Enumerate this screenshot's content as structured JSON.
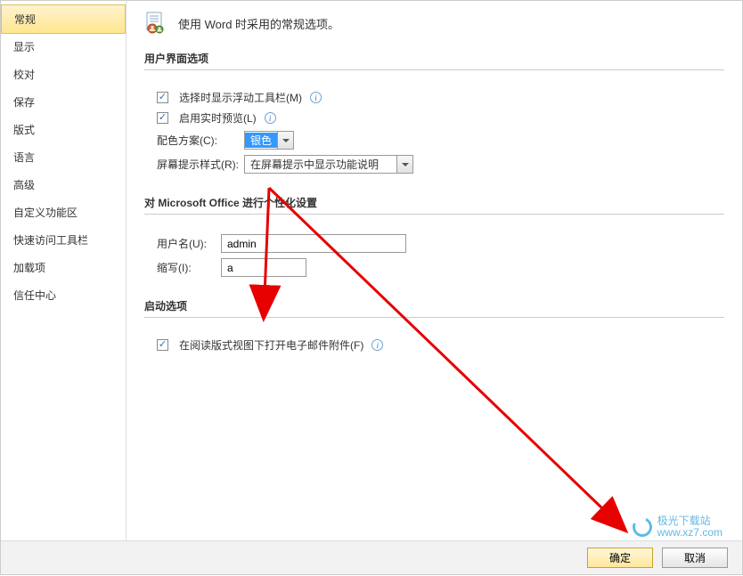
{
  "header": {
    "title": "使用 Word 时采用的常规选项。"
  },
  "sidebar": {
    "items": [
      {
        "label": "常规",
        "selected": true
      },
      {
        "label": "显示",
        "selected": false
      },
      {
        "label": "校对",
        "selected": false
      },
      {
        "label": "保存",
        "selected": false
      },
      {
        "label": "版式",
        "selected": false
      },
      {
        "label": "语言",
        "selected": false
      },
      {
        "label": "高级",
        "selected": false
      },
      {
        "label": "自定义功能区",
        "selected": false
      },
      {
        "label": "快速访问工具栏",
        "selected": false
      },
      {
        "label": "加载项",
        "selected": false
      },
      {
        "label": "信任中心",
        "selected": false
      }
    ]
  },
  "sections": {
    "ui_options": {
      "title": "用户界面选项",
      "show_mini_toolbar": {
        "label": "选择时显示浮动工具栏(M)",
        "checked": true
      },
      "live_preview": {
        "label": "启用实时预览(L)",
        "checked": true
      },
      "color_scheme": {
        "label": "配色方案(C):",
        "value": "银色"
      },
      "screentip": {
        "label": "屏幕提示样式(R):",
        "value": "在屏幕提示中显示功能说明"
      }
    },
    "personalize": {
      "title": "对 Microsoft Office 进行个性化设置",
      "username": {
        "label": "用户名(U):",
        "value": "admin"
      },
      "initials": {
        "label": "缩写(I):",
        "value": "a"
      }
    },
    "startup": {
      "title": "启动选项",
      "open_attachments": {
        "label": "在阅读版式视图下打开电子邮件附件(F)",
        "checked": true
      }
    }
  },
  "footer": {
    "ok": "确定",
    "cancel": "取消"
  },
  "watermark": {
    "name": "极光下载站",
    "url": "www.xz7.com"
  }
}
